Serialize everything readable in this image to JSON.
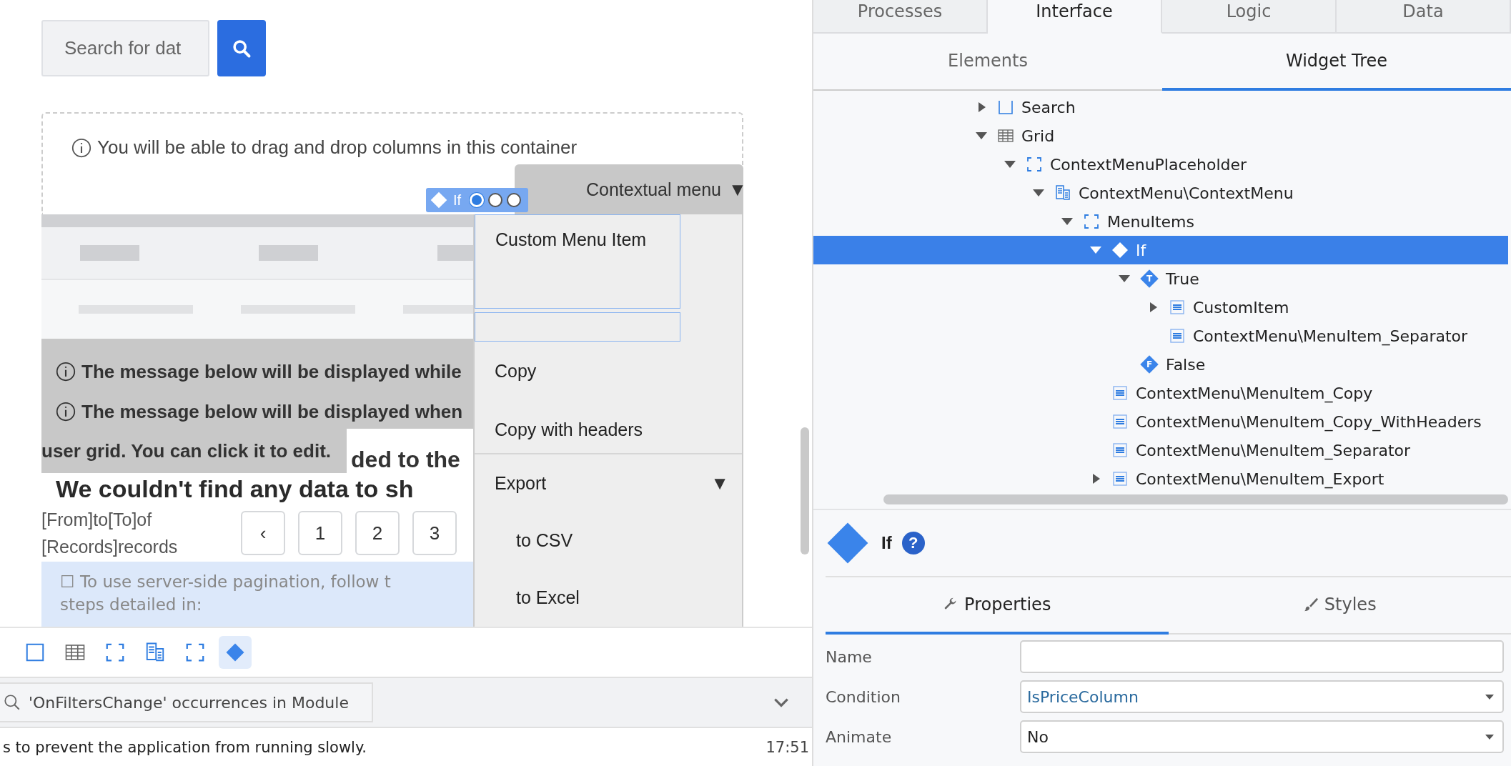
{
  "canvas": {
    "search": {
      "placeholder": "Search for dat"
    },
    "container_hint": "You will be able to drag and drop columns in this container",
    "contextual_menu": {
      "title": "Contextual menu",
      "title_arrow": "▼",
      "items": [
        {
          "kind": "custom",
          "label": "Custom Menu Item"
        },
        {
          "kind": "blank"
        },
        {
          "kind": "item",
          "label": "Copy"
        },
        {
          "kind": "item",
          "label": "Copy with headers"
        },
        {
          "kind": "separator"
        },
        {
          "kind": "submenu",
          "label": "Export",
          "arrow": "▼"
        },
        {
          "kind": "subitem",
          "label": "to CSV"
        },
        {
          "kind": "subitem",
          "label": "to Excel"
        }
      ]
    },
    "if_badge": {
      "label": "If",
      "branches": [
        {
          "selected": true
        },
        {
          "selected": false
        },
        {
          "selected": false
        }
      ]
    },
    "messages": [
      "The message below will be displayed while",
      "The message below will be displayed when"
    ],
    "message_tail": "user grid. You can click it to edit.",
    "hidden_fragment": "ded to the",
    "empty_title": "We couldn't find any data to sh",
    "records_text": [
      "[From]to[To]of",
      "[Records]records"
    ],
    "pagination": [
      "‹",
      "1",
      "2",
      "3"
    ],
    "pagination_note": [
      "☐ To use server-side pagination, follow t",
      "steps detailed in:"
    ]
  },
  "breadcrumb": [
    {
      "kind": "container",
      "selected": false
    },
    {
      "kind": "table",
      "selected": false
    },
    {
      "kind": "placeholder",
      "selected": false
    },
    {
      "kind": "block",
      "selected": false
    },
    {
      "kind": "placeholder",
      "selected": false
    },
    {
      "kind": "if",
      "selected": true
    }
  ],
  "search_results": {
    "title": "'OnFiltersChange' occurrences in Module"
  },
  "status": {
    "message": "s to prevent the application from running slowly.",
    "time": "17:51"
  },
  "tabs": [
    {
      "label": "Processes",
      "selected": false
    },
    {
      "label": "Interface",
      "selected": true
    },
    {
      "label": "Logic",
      "selected": false
    },
    {
      "label": "Data",
      "selected": false
    }
  ],
  "subtabs": [
    {
      "label": "Elements",
      "selected": false
    },
    {
      "label": "Widget Tree",
      "selected": true
    }
  ],
  "tree": [
    {
      "label": "Search",
      "kind": "container",
      "expanded": false,
      "selected": false
    },
    {
      "label": "Grid",
      "kind": "table",
      "expanded": true,
      "selected": false,
      "children": [
        {
          "label": "ContextMenuPlaceholder",
          "kind": "placeholder",
          "expanded": true,
          "selected": false,
          "children": [
            {
              "label": "ContextMenu\\ContextMenu",
              "kind": "block",
              "expanded": true,
              "selected": false,
              "children": [
                {
                  "label": "MenuItems",
                  "kind": "placeholder",
                  "expanded": true,
                  "selected": false,
                  "children": [
                    {
                      "label": "If",
                      "kind": "if",
                      "expanded": true,
                      "selected": true,
                      "children": [
                        {
                          "label": "True",
                          "kind": "branch",
                          "badge": "T",
                          "expanded": true,
                          "selected": false,
                          "children": [
                            {
                              "label": "CustomItem",
                              "kind": "item",
                              "expanded": false,
                              "selected": false
                            },
                            {
                              "label": "ContextMenu\\MenuItem_Separator",
                              "kind": "item",
                              "selected": false
                            }
                          ]
                        },
                        {
                          "label": "False",
                          "kind": "branch",
                          "badge": "F",
                          "selected": false
                        }
                      ]
                    },
                    {
                      "label": "ContextMenu\\MenuItem_Copy",
                      "kind": "item",
                      "selected": false
                    },
                    {
                      "label": "ContextMenu\\MenuItem_Copy_WithHeaders",
                      "kind": "item",
                      "selected": false
                    },
                    {
                      "label": "ContextMenu\\MenuItem_Separator",
                      "kind": "item",
                      "selected": false
                    },
                    {
                      "label": "ContextMenu\\MenuItem_Export",
                      "kind": "item",
                      "expanded": false,
                      "selected": false
                    }
                  ]
                }
              ]
            }
          ]
        }
      ]
    }
  ],
  "properties": {
    "title": "If",
    "help": "?",
    "tabs": [
      {
        "label": "Properties",
        "kind": "wrench",
        "selected": true
      },
      {
        "label": "Styles",
        "kind": "brush",
        "selected": false
      }
    ],
    "fields": [
      {
        "label": "Name",
        "kind": "text"
      },
      {
        "label": "Condition",
        "kind": "expression",
        "value": "IsPriceColumn"
      },
      {
        "label": "Animate",
        "kind": "dropdown",
        "value": "No"
      }
    ]
  }
}
